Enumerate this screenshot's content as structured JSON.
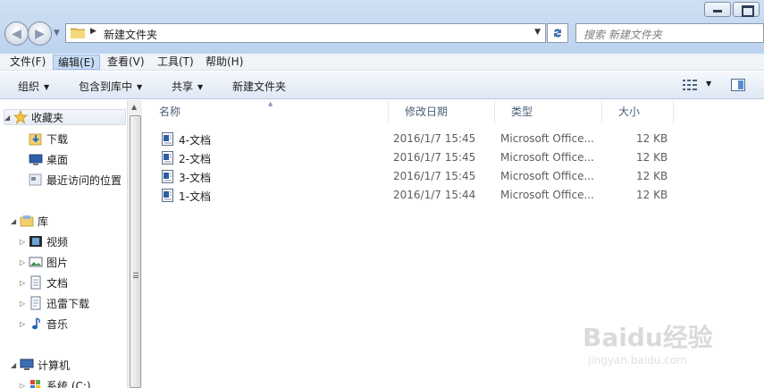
{
  "address": {
    "crumb": "新建文件夹",
    "search_placeholder": "搜索 新建文件夹"
  },
  "menu": [
    "文件(F)",
    "编辑(E)",
    "查看(V)",
    "工具(T)",
    "帮助(H)"
  ],
  "toolbar": {
    "organize": "组织",
    "include_library": "包含到库中",
    "share": "共享",
    "new_folder": "新建文件夹"
  },
  "nav": {
    "favorites": "收藏夹",
    "downloads": "下载",
    "desktop": "桌面",
    "recent": "最近访问的位置",
    "libraries": "库",
    "videos": "视频",
    "pictures": "图片",
    "documents": "文档",
    "thunder": "迅雷下载",
    "music": "音乐",
    "computer": "计算机",
    "system_c": "系统 (C:)"
  },
  "columns": {
    "name": "名称",
    "modified": "修改日期",
    "type": "类型",
    "size": "大小"
  },
  "files": [
    {
      "name": "4-文档",
      "modified": "2016/1/7 15:45",
      "type": "Microsoft Office...",
      "size": "12 KB"
    },
    {
      "name": "2-文档",
      "modified": "2016/1/7 15:45",
      "type": "Microsoft Office...",
      "size": "12 KB"
    },
    {
      "name": "3-文档",
      "modified": "2016/1/7 15:45",
      "type": "Microsoft Office...",
      "size": "12 KB"
    },
    {
      "name": "1-文档",
      "modified": "2016/1/7 15:44",
      "type": "Microsoft Office...",
      "size": "12 KB"
    }
  ],
  "watermark": {
    "brand": "Baidu经验",
    "url": "jingyan.baidu.com"
  }
}
